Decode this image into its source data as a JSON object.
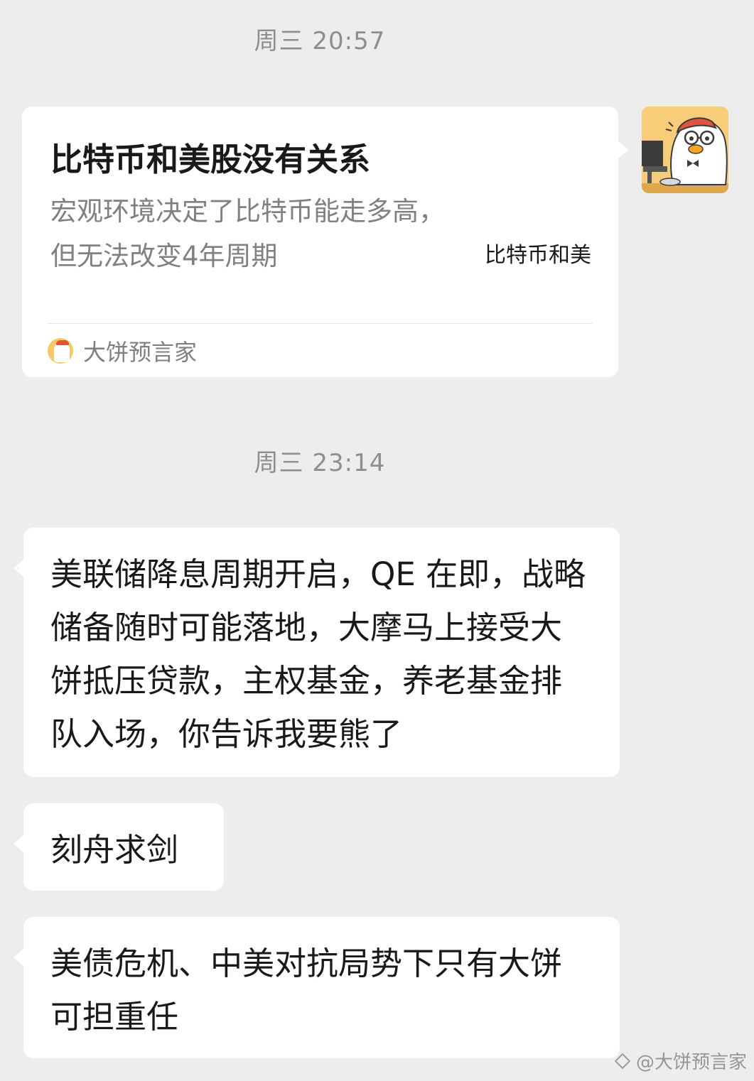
{
  "chat": {
    "timestamps": [
      "周三 20:57",
      "周三 23:14"
    ],
    "link_card": {
      "title": "比特币和美股没有关系",
      "description": "宏观环境决定了比特币能走多高，但无法改变4年周期",
      "thumbnail_text": "比特币和美",
      "source_name": "大饼预言家",
      "source_avatar_icon": "duck-mascot-icon"
    },
    "sender_avatar_icon": "duck-mascot-avatar",
    "messages": [
      {
        "text": "美联储降息周期开启，QE 在即，战略储备随时可能落地，大摩马上接受大饼抵压贷款，主权基金，养老基金排队入场，你告诉我要熊了"
      },
      {
        "text": "刻舟求剑"
      },
      {
        "text": "美债危机、中美对抗局势下只有大饼可担重任"
      }
    ]
  },
  "watermark": {
    "text": "@大饼预言家",
    "icon": "diamond-logo-icon"
  },
  "colors": {
    "background": "#ededed",
    "bubble": "#ffffff",
    "timestamp": "#8e8e8e",
    "text": "#191919"
  }
}
